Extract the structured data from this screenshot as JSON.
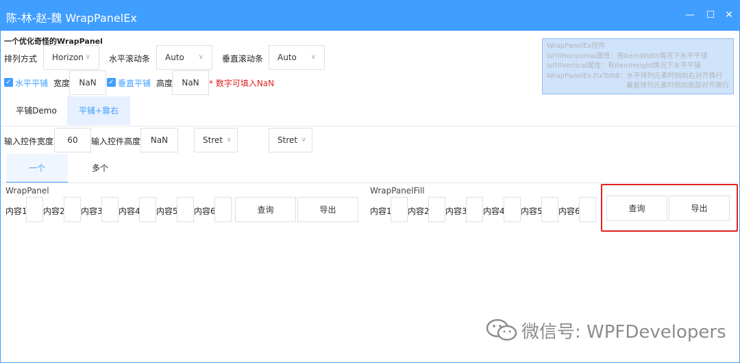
{
  "window": {
    "title": "陈-林-赵-魏 WrapPanelEx",
    "minimize": "—",
    "maximize": "☐",
    "close": "✕"
  },
  "heading": "一个优化奇怪的WrapPanel",
  "row1": {
    "arrange_label": "排列方式",
    "arrange_value": "Horizon",
    "hscroll_label": "水平滚动条",
    "hscroll_value": "Auto",
    "vscroll_label": "垂直滚动条",
    "vscroll_value": "Auto"
  },
  "row2": {
    "hfill_label": "水平平铺",
    "width_label": "宽度",
    "width_value": "NaN",
    "vfill_label": "垂直平铺",
    "height_label": "高度",
    "height_value": "NaN",
    "hint": "* 数字可填入NaN"
  },
  "info": [
    "WrapPanelEx控件",
    "IsFillHorizontal属性：有ItemWidth情况下水平平铺",
    "IsFillVertical属性：有ItemHeight情况下水平平铺",
    "WrapPanelEx.FixToRB：水平排列元素时则向右对齐换行",
    "垂直排列元素时则向底部对齐换行"
  ],
  "tabs": [
    "平铺Demo",
    "平铺+靠右"
  ],
  "row3": {
    "input_width_label": "输入控件宽度",
    "input_width_value": "60",
    "input_height_label": "输入控件高度",
    "input_height_value": "NaN",
    "align1": "Stret",
    "align2": "Stret"
  },
  "subtabs": [
    "一个",
    "多个"
  ],
  "panel_left": {
    "title": "WrapPanel",
    "items": [
      "内容1",
      "内容2",
      "内容3",
      "内容4",
      "内容5",
      "内容6"
    ],
    "query": "查询",
    "export": "导出"
  },
  "panel_right": {
    "title": "WrapPanelFill",
    "items": [
      "内容1",
      "内容2",
      "内容3",
      "内容4",
      "内容5",
      "内容6"
    ],
    "query": "查询",
    "export": "导出"
  },
  "watermark": "微信号: WPFDevelopers",
  "colors": {
    "accent": "#409eff",
    "highlight_box": "#e02020"
  }
}
